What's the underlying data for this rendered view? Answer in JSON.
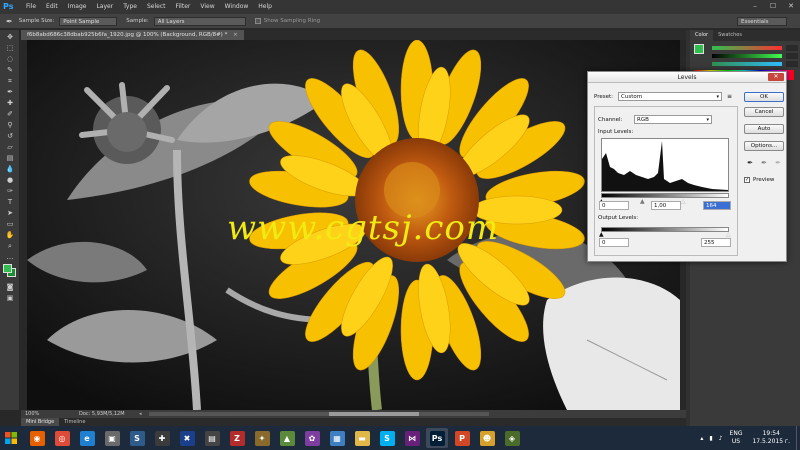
{
  "app": {
    "logo": "Ps"
  },
  "menubar": {
    "items": [
      "File",
      "Edit",
      "Image",
      "Layer",
      "Type",
      "Select",
      "Filter",
      "View",
      "Window",
      "Help"
    ],
    "controls": [
      "–",
      "☐",
      "✕"
    ]
  },
  "options": {
    "sample_size_label": "Sample Size:",
    "sample_size_value": "Point Sample",
    "sample_label": "Sample:",
    "sample_value": "All Layers",
    "sampling_ring_label": "Show Sampling Ring",
    "workspace": "Essentials"
  },
  "document": {
    "tab_title": "f6b8abd686c38dbab925b6fa_1920.jpg @ 100% (Background, RGB/8#) *",
    "watermark": "www.cgtsj.com"
  },
  "status": {
    "zoom": "100%",
    "doc_info": "Doc: 5,93M/5,12M"
  },
  "bottom_tabs": [
    "Mini Bridge",
    "Timeline"
  ],
  "panels": {
    "tabs": [
      "Color",
      "Swatches"
    ],
    "colors": {
      "foreground": "#2fbf4f",
      "background": "#1d8c32"
    }
  },
  "levels": {
    "title": "Levels",
    "preset_label": "Preset:",
    "preset_value": "Custom",
    "channel_label": "Channel:",
    "channel_value": "RGB",
    "input_levels_label": "Input Levels:",
    "input_black": "0",
    "input_gamma": "1,00",
    "input_white": "164",
    "output_levels_label": "Output Levels:",
    "output_black": "0",
    "output_white": "255",
    "buttons": {
      "ok": "OK",
      "cancel": "Cancel",
      "auto": "Auto",
      "options": "Options..."
    },
    "preview_label": "Preview",
    "preview_checked": true
  },
  "taskbar": {
    "apps": [
      {
        "name": "firefox-icon",
        "bg": "#e66000",
        "glyph": "◉"
      },
      {
        "name": "chrome-icon",
        "bg": "#dd4b39",
        "glyph": "◎"
      },
      {
        "name": "internet-explorer-icon",
        "bg": "#1f7fd0",
        "glyph": "e"
      },
      {
        "name": "app-icon-4",
        "bg": "#6a6a6a",
        "glyph": "▣"
      },
      {
        "name": "app-s-icon",
        "bg": "#2f5b8a",
        "glyph": "S"
      },
      {
        "name": "app-flag-icon",
        "bg": "#3b3b3b",
        "glyph": "✚"
      },
      {
        "name": "app-uk-icon",
        "bg": "#1b3f8a",
        "glyph": "✖"
      },
      {
        "name": "app-media-icon",
        "bg": "#444",
        "glyph": "▤"
      },
      {
        "name": "filezilla-icon",
        "bg": "#b32c2c",
        "glyph": "Z"
      },
      {
        "name": "app-tool-icon",
        "bg": "#8a6a2c",
        "glyph": "✦"
      },
      {
        "name": "image-viewer-icon",
        "bg": "#5b8a3c",
        "glyph": "▲"
      },
      {
        "name": "app-photo-icon",
        "bg": "#7d3ea0",
        "glyph": "✿"
      },
      {
        "name": "file-manager-icon",
        "bg": "#3d7fc0",
        "glyph": "▦"
      },
      {
        "name": "folder-icon",
        "bg": "#e0b84a",
        "glyph": "▬"
      },
      {
        "name": "skype-icon",
        "bg": "#00aff0",
        "glyph": "S"
      },
      {
        "name": "visual-studio-icon",
        "bg": "#68217a",
        "glyph": "⋈"
      },
      {
        "name": "photoshop-icon",
        "bg": "#001e36",
        "glyph": "Ps",
        "active": true
      },
      {
        "name": "powerpoint-icon",
        "bg": "#d24726",
        "glyph": "P"
      },
      {
        "name": "app-user-icon",
        "bg": "#d6a12a",
        "glyph": "☻"
      },
      {
        "name": "app-game-icon",
        "bg": "#4a6b2a",
        "glyph": "◈"
      }
    ],
    "lang_top": "ENG",
    "lang_bottom": "US",
    "time": "19:54",
    "date": "17.5.2015 г."
  }
}
